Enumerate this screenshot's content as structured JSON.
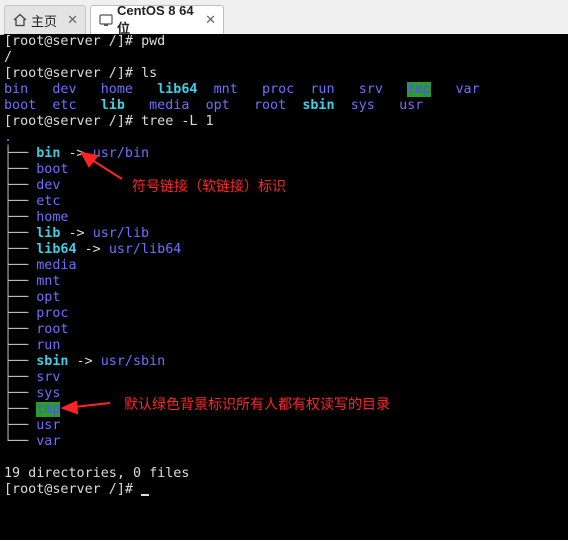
{
  "tabs": [
    {
      "label": "主页",
      "icon": "home-icon"
    },
    {
      "label": "CentOS 8 64 位",
      "icon": "vm-icon"
    }
  ],
  "terminal": {
    "prompt": "[root@server /]# ",
    "cmd1": "pwd",
    "out1": "/",
    "cmd2": "ls",
    "ls_row1": [
      "bin",
      "dev",
      "home",
      "lib64",
      "mnt",
      "proc",
      "run",
      "srv",
      "tmp",
      "var"
    ],
    "ls_row2": [
      "boot",
      "etc",
      "lib",
      "media",
      "opt",
      "root",
      "sbin",
      "sys",
      "usr"
    ],
    "cmd3": "tree -L 1",
    "tree_root": ".",
    "tree_branch": "├── ",
    "tree_last": "└── ",
    "arrow": " -> ",
    "tree": [
      {
        "name": "bin",
        "target": "usr/bin"
      },
      {
        "name": "boot"
      },
      {
        "name": "dev"
      },
      {
        "name": "etc"
      },
      {
        "name": "home"
      },
      {
        "name": "lib",
        "target": "usr/lib"
      },
      {
        "name": "lib64",
        "target": "usr/lib64"
      },
      {
        "name": "media"
      },
      {
        "name": "mnt"
      },
      {
        "name": "opt"
      },
      {
        "name": "proc"
      },
      {
        "name": "root"
      },
      {
        "name": "run"
      },
      {
        "name": "sbin",
        "target": "usr/sbin"
      },
      {
        "name": "srv"
      },
      {
        "name": "sys"
      },
      {
        "name": "tmp"
      },
      {
        "name": "usr"
      },
      {
        "name": "var"
      }
    ],
    "summary": "19 directories, 0 files"
  },
  "annotations": {
    "symlink": "符号链接（软链接）标识",
    "tmp": "默认绿色背景标识所有人都有权读写的目录"
  },
  "colors": {
    "directory": "#6f6fff",
    "symlink": "#3fd0e8",
    "sticky_bg": "#2a9d2a",
    "annotation": "#ff2424"
  }
}
